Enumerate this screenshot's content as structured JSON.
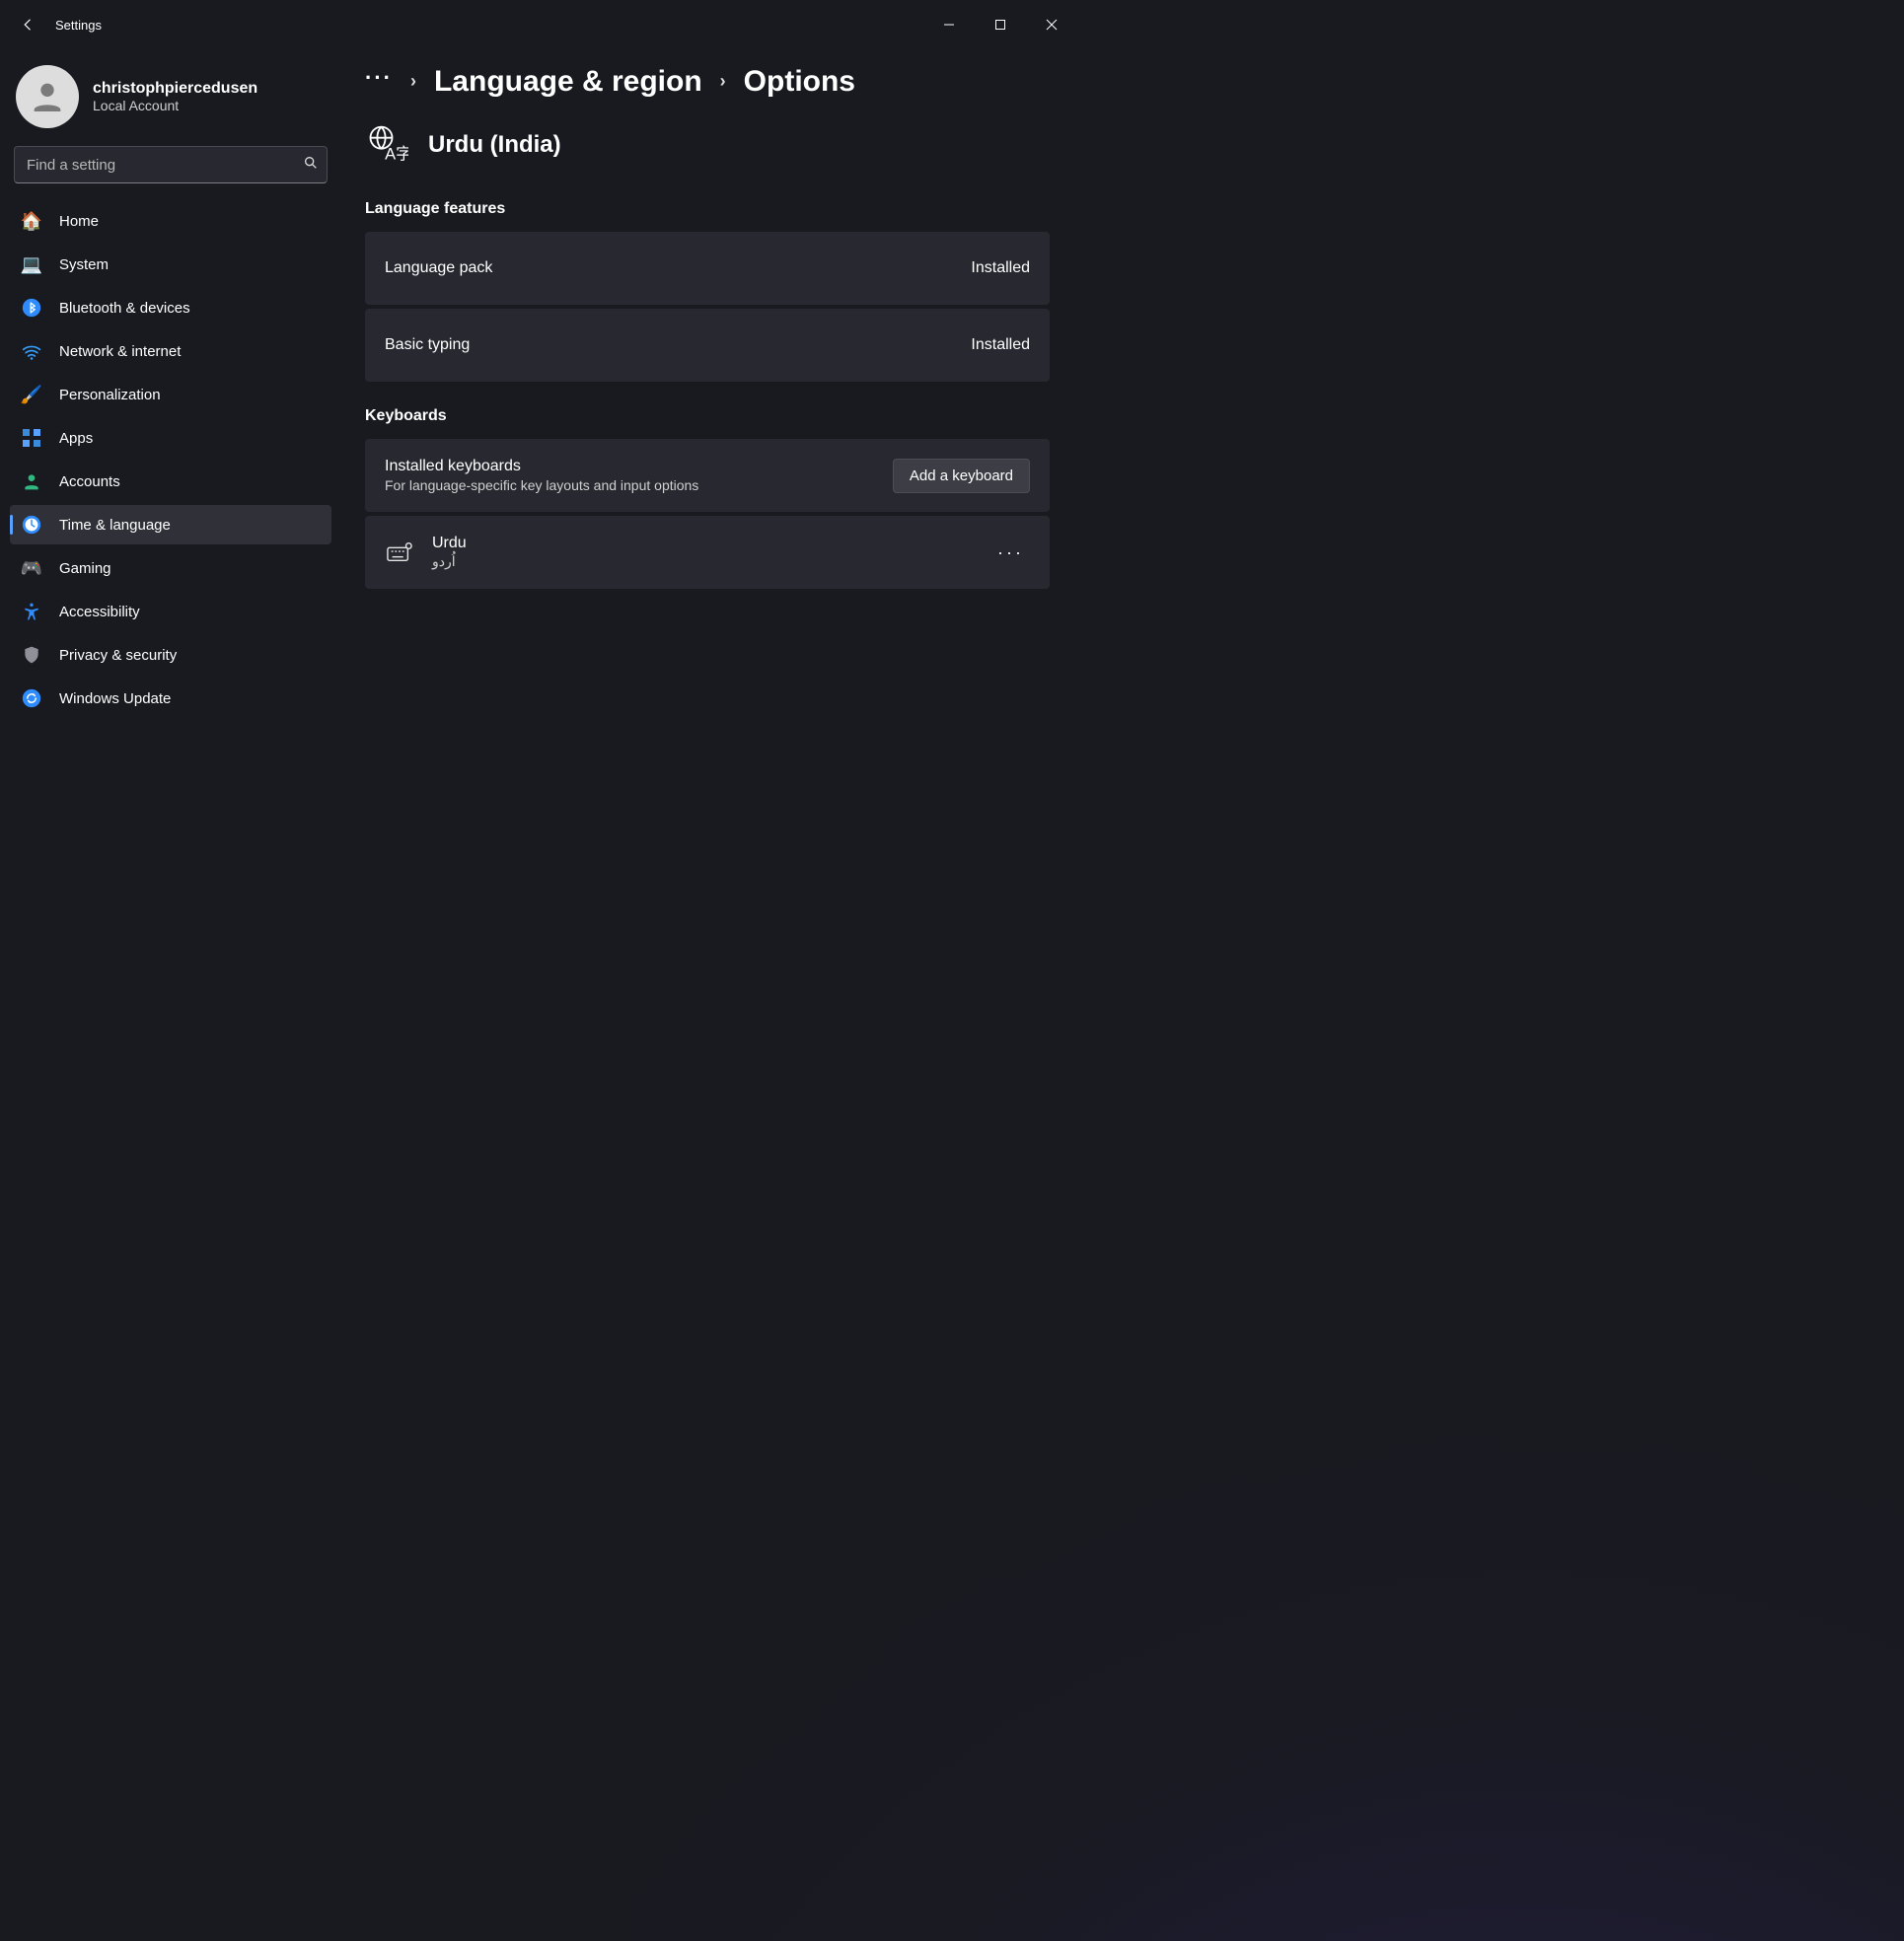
{
  "window": {
    "title": "Settings"
  },
  "profile": {
    "name": "christophpiercedusen",
    "sub": "Local Account"
  },
  "search": {
    "placeholder": "Find a setting"
  },
  "sidebar": {
    "items": [
      {
        "label": "Home",
        "icon": "home-icon"
      },
      {
        "label": "System",
        "icon": "system-icon"
      },
      {
        "label": "Bluetooth & devices",
        "icon": "bluetooth-icon"
      },
      {
        "label": "Network & internet",
        "icon": "network-icon"
      },
      {
        "label": "Personalization",
        "icon": "personalization-icon"
      },
      {
        "label": "Apps",
        "icon": "apps-icon"
      },
      {
        "label": "Accounts",
        "icon": "accounts-icon"
      },
      {
        "label": "Time & language",
        "icon": "time-language-icon"
      },
      {
        "label": "Gaming",
        "icon": "gaming-icon"
      },
      {
        "label": "Accessibility",
        "icon": "accessibility-icon"
      },
      {
        "label": "Privacy & security",
        "icon": "privacy-icon"
      },
      {
        "label": "Windows Update",
        "icon": "update-icon"
      }
    ],
    "selected_index": 7
  },
  "breadcrumb": {
    "overflow": "···",
    "parent": "Language & region",
    "current": "Options"
  },
  "language": {
    "name": "Urdu (India)"
  },
  "sections": {
    "features": {
      "title": "Language features",
      "items": [
        {
          "label": "Language pack",
          "status": "Installed"
        },
        {
          "label": "Basic typing",
          "status": "Installed"
        }
      ]
    },
    "keyboards": {
      "title": "Keyboards",
      "installed_title": "Installed keyboards",
      "installed_sub": "For language-specific key layouts and input options",
      "add_button": "Add a keyboard",
      "list": [
        {
          "name": "Urdu",
          "native": "اُردو"
        }
      ]
    }
  }
}
